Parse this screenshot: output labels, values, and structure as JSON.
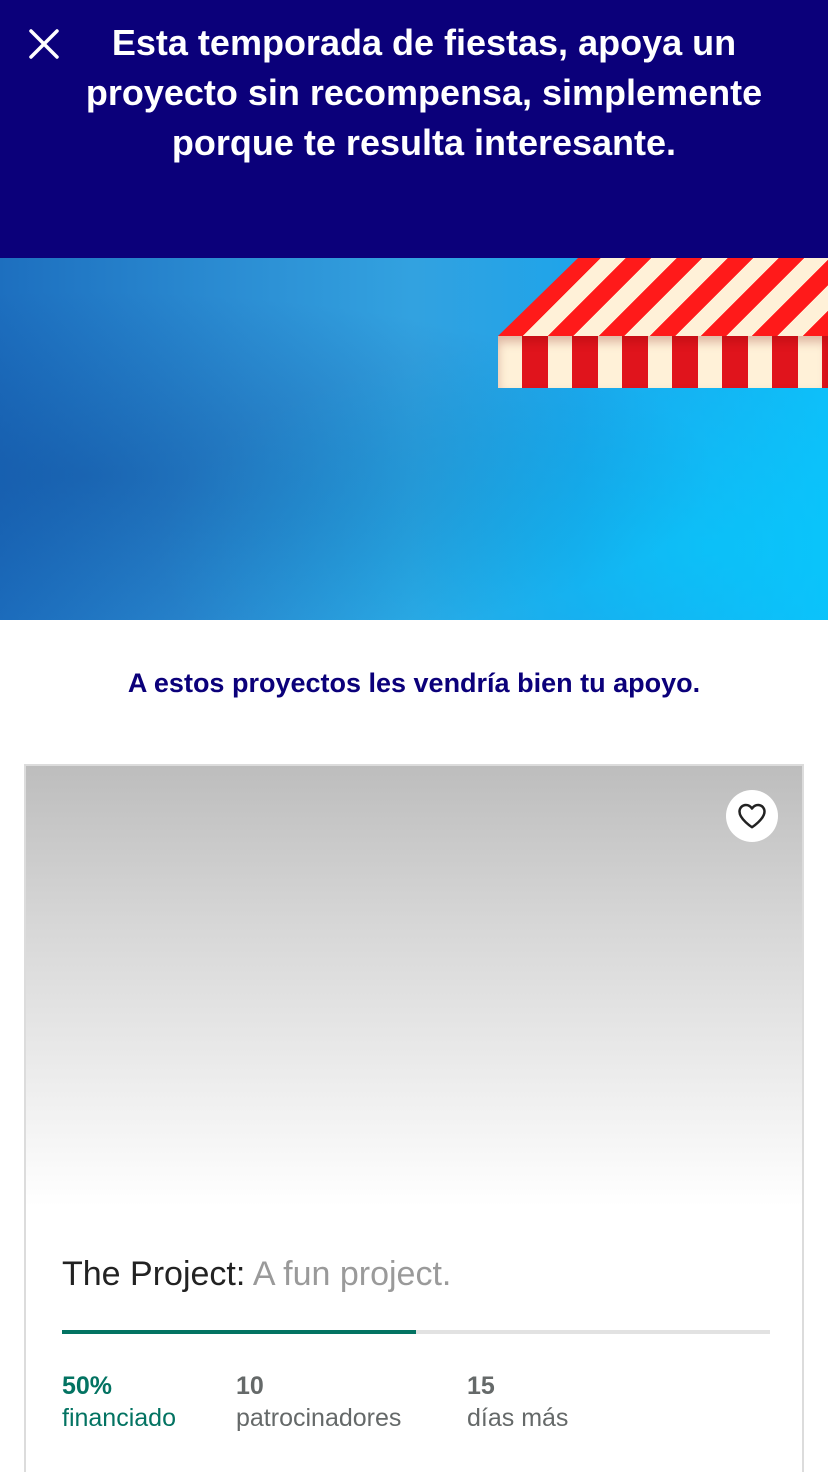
{
  "banner": {
    "message": "Esta temporada de fiestas, apoya un proyecto sin recompensa, simplemente porque te resulta interesante."
  },
  "section": {
    "subtitle": "A estos proyectos les vendría bien tu apoyo."
  },
  "icons": {
    "close": "close-icon",
    "favorite": "heart-outline-icon"
  },
  "project": {
    "name": "The Project:",
    "blurb": " A fun project.",
    "funded_fraction": 0.5,
    "stats": [
      {
        "value": "50%",
        "label": "financiado"
      },
      {
        "value": "10",
        "label": "patrocinadores"
      },
      {
        "value": "15",
        "label": "días más"
      }
    ]
  },
  "colors": {
    "banner_bg": "#0b007a",
    "accent_green": "#037362",
    "awning_red": "#e0141c"
  }
}
